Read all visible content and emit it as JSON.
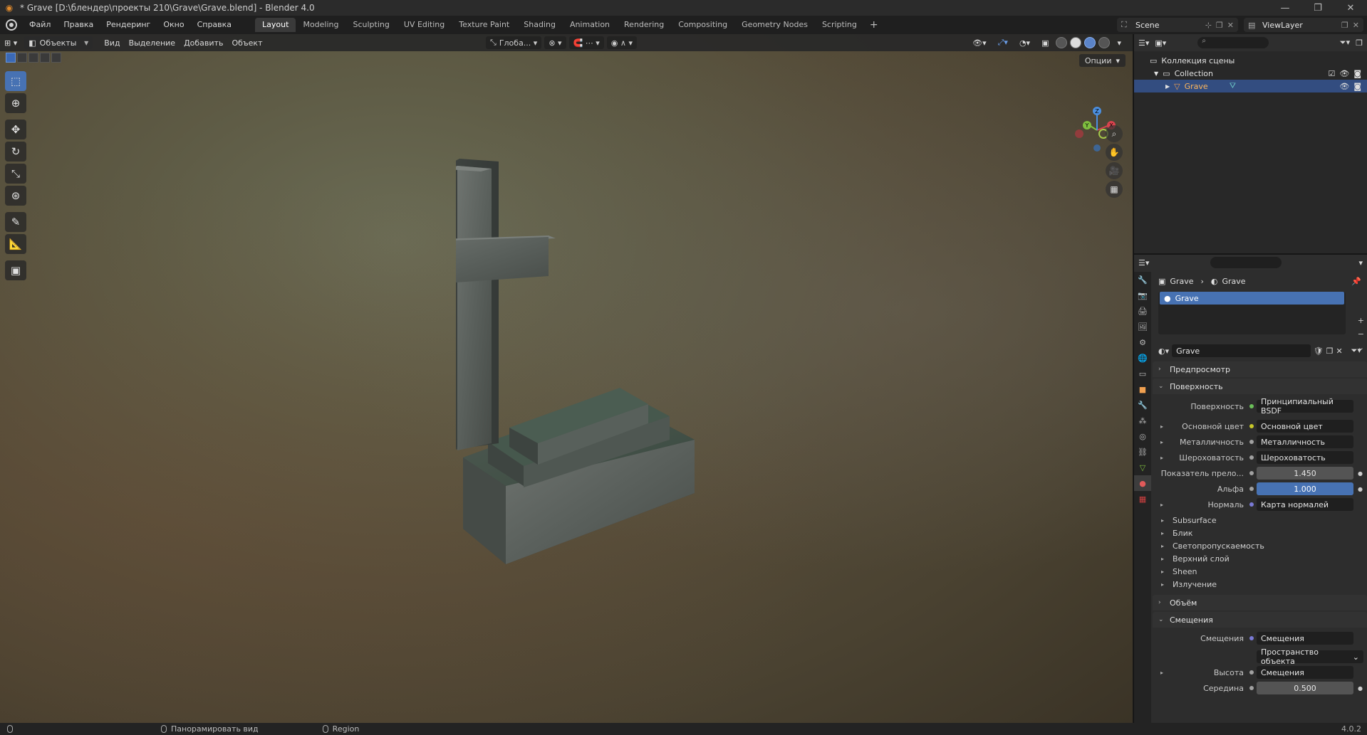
{
  "window": {
    "title": "* Grave [D:\\блендер\\проекты 210\\Grave\\Grave.blend] - Blender 4.0",
    "controls": [
      "—",
      "❐",
      "✕"
    ]
  },
  "menubar": {
    "menus": [
      "Файл",
      "Правка",
      "Рендеринг",
      "Окно",
      "Справка"
    ],
    "workspaces": [
      "Layout",
      "Modeling",
      "Sculpting",
      "UV Editing",
      "Texture Paint",
      "Shading",
      "Animation",
      "Rendering",
      "Compositing",
      "Geometry Nodes",
      "Scripting"
    ],
    "active_workspace": "Layout",
    "add_workspace": "+",
    "scene": "Scene",
    "view_layer": "ViewLayer"
  },
  "viewport": {
    "mode": "Объекты",
    "menus": [
      "Вид",
      "Выделение",
      "Добавить",
      "Объект"
    ],
    "transform_orientation": "Глоба...",
    "options": "Опции",
    "gizmo_axes": {
      "x": "X",
      "y": "Y",
      "z": "Z"
    }
  },
  "outliner": {
    "scene_collection": "Коллекция сцены",
    "collection": "Collection",
    "object": "Grave"
  },
  "properties": {
    "breadcrumb": {
      "object": "Grave",
      "material": "Grave"
    },
    "material_slot": "Grave",
    "material_name": "Grave",
    "panels": {
      "preview": "Предпросмотр",
      "surface": "Поверхность",
      "volume": "Объём",
      "displacement": "Смещения"
    },
    "surface_rows": [
      {
        "label": "Поверхность",
        "value": "Принципиальный BSDF",
        "dot": "#6bbf59",
        "arrow": ""
      },
      {
        "label": "Основной цвет",
        "value": "Основной цвет",
        "dot": "#c7c729",
        "arrow": "▸"
      },
      {
        "label": "Металличность",
        "value": "Металличность",
        "dot": "#a1a1a1",
        "arrow": "▸"
      },
      {
        "label": "Шероховатость",
        "value": "Шероховатость",
        "dot": "#a1a1a1",
        "arrow": "▸"
      }
    ],
    "ior": {
      "label": "Показатель прело...",
      "value": "1.450"
    },
    "alpha": {
      "label": "Альфа",
      "value": "1.000"
    },
    "normal": {
      "label": "Нормаль",
      "value": "Карта нормалей"
    },
    "subpanels": [
      "Subsurface",
      "Блик",
      "Светопропускаемость",
      "Верхний слой",
      "Sheen",
      "Излучение"
    ],
    "displacement": {
      "label": "Смещения",
      "value": "Смещения",
      "space": "Пространство объекта",
      "height_label": "Высота",
      "height_value": "Смещения",
      "midlevel_label": "Середина",
      "midlevel_value": "0.500"
    }
  },
  "statusbar": {
    "pan": "Панорамировать вид",
    "region": "Region",
    "version": "4.0.2"
  },
  "colors": {
    "accent": "#4772b3",
    "selection": "#334d80",
    "x_axis": "#d9434e",
    "y_axis": "#7fbf3f",
    "z_axis": "#4b8fe0"
  }
}
